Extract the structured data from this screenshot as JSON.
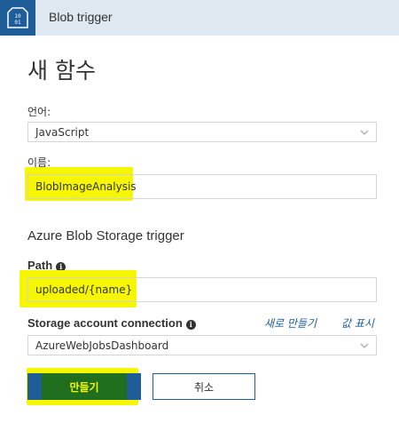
{
  "header": {
    "title": "Blob trigger",
    "logo_icon": "azure-function-icon"
  },
  "page": {
    "title": "새 함수"
  },
  "language": {
    "label": "언어:",
    "value": "JavaScript"
  },
  "name": {
    "label": "이름:",
    "value": "BlobImageAnalysis"
  },
  "section": {
    "title": "Azure Blob Storage trigger"
  },
  "path": {
    "label": "Path",
    "value": "uploaded/{name}"
  },
  "storage": {
    "label": "Storage account connection",
    "value": "AzureWebJobsDashboard",
    "new_link": "새로 만들기",
    "show_link": "값 표시"
  },
  "buttons": {
    "create": "만들기",
    "cancel": "취소"
  },
  "colors": {
    "accent": "#1e5d97",
    "highlight": "#f6f600",
    "header_bg": "#dde8f0"
  }
}
